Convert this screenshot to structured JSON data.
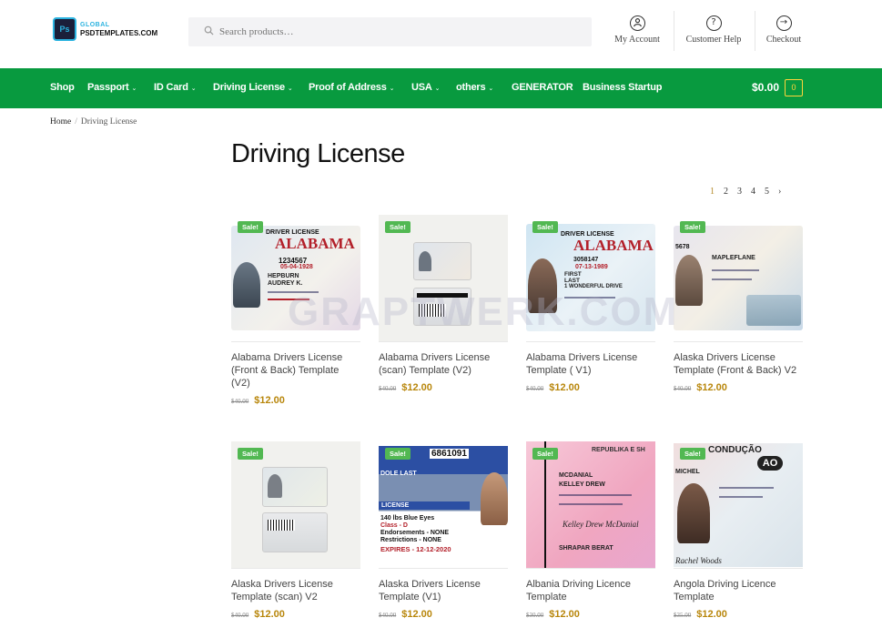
{
  "header": {
    "logo_line1": "GLOBAL",
    "logo_line2": "PSDTEMPLATES.COM",
    "logo_mark": "Ps",
    "search_placeholder": "Search products…",
    "links": [
      {
        "label": "My Account",
        "icon": "user-icon"
      },
      {
        "label": "Customer Help",
        "icon": "help-icon"
      },
      {
        "label": "Checkout",
        "icon": "arrow-right-icon"
      }
    ]
  },
  "nav": {
    "items": [
      {
        "label": "Shop",
        "dropdown": false
      },
      {
        "label": "Passport",
        "dropdown": true
      },
      {
        "label": "ID Card",
        "dropdown": true
      },
      {
        "label": "Driving License",
        "dropdown": true
      },
      {
        "label": "Proof of Address",
        "dropdown": true
      },
      {
        "label": "USA",
        "dropdown": true
      },
      {
        "label": "others",
        "dropdown": true
      },
      {
        "label": "GENERATOR",
        "dropdown": false
      },
      {
        "label": "Business Startup",
        "dropdown": false
      }
    ],
    "cart_total": "$0.00",
    "cart_count": "0"
  },
  "breadcrumb": {
    "home": "Home",
    "current": "Driving License"
  },
  "page_title": "Driving License",
  "pagination": {
    "pages": [
      "1",
      "2",
      "3",
      "4",
      "5"
    ],
    "current": "1",
    "next": "›"
  },
  "products": [
    {
      "title": "Alabama Drivers License (Front & Back) Template (V2)",
      "old_price": "$40.00",
      "price": "$12.00",
      "badge": "Sale!"
    },
    {
      "title": "Alabama Drivers License (scan) Template (V2)",
      "old_price": "$40.00",
      "price": "$12.00",
      "badge": "Sale!"
    },
    {
      "title": "Alabama Drivers License Template ( V1)",
      "old_price": "$40.00",
      "price": "$12.00",
      "badge": "Sale!"
    },
    {
      "title": "Alaska Drivers License Template (Front & Back) V2",
      "old_price": "$40.00",
      "price": "$12.00",
      "badge": "Sale!"
    },
    {
      "title": "Alaska Drivers License Template (scan) V2",
      "old_price": "$40.00",
      "price": "$12.00",
      "badge": "Sale!"
    },
    {
      "title": "Alaska Drivers License Template (V1)",
      "old_price": "$40.00",
      "price": "$12.00",
      "badge": "Sale!"
    },
    {
      "title": "Albania Driving Licence Template",
      "old_price": "$30.00",
      "price": "$12.00",
      "badge": "Sale!"
    },
    {
      "title": "Angola Driving Licence Template",
      "old_price": "$35.00",
      "price": "$12.00",
      "badge": "Sale!"
    }
  ],
  "card_text": {
    "p0": {
      "header": "DRIVER LICENSE",
      "state": "ALABAMA",
      "no": "1234567",
      "dob": "05-04-1928",
      "name1": "HEPBURN",
      "name2": "AUDREY K."
    },
    "p2": {
      "header": "DRIVER LICENSE",
      "state": "ALABAMA",
      "no": "3058147",
      "dob": "07-13-1989",
      "first": "FIRST",
      "last": "LAST",
      "addr": "1 WONDERFUL DRIVE"
    },
    "p3": {
      "no": "5678",
      "name": "MAPLEFLANE"
    },
    "p5": {
      "no": "6861091",
      "name": "DOLE LAST",
      "section": "LICENSE",
      "stats": "140 lbs  Blue Eyes",
      "class": "Class - D",
      "end": "Endorsements - NONE",
      "restr": "Restrictions - NONE",
      "expires": "EXPIRES - 12-12-2020"
    },
    "p6": {
      "country": "REPUBLIKA E SH",
      "name1": "MCDANIAL",
      "name2": "KELLEY DREW",
      "sig": "Kelley Drew McDanial",
      "place": "SHRAPAR BERAT"
    },
    "p7": {
      "country": "CONDUÇÃO",
      "code": "AO",
      "name": "MICHEL",
      "sig": "Rachel Woods"
    }
  },
  "watermark": "GRAPTWERK.COM",
  "colors": {
    "nav_bg": "#089a3f",
    "sale_badge": "#52b852",
    "price": "#b8860b",
    "cart_accent": "#ffd43b"
  }
}
